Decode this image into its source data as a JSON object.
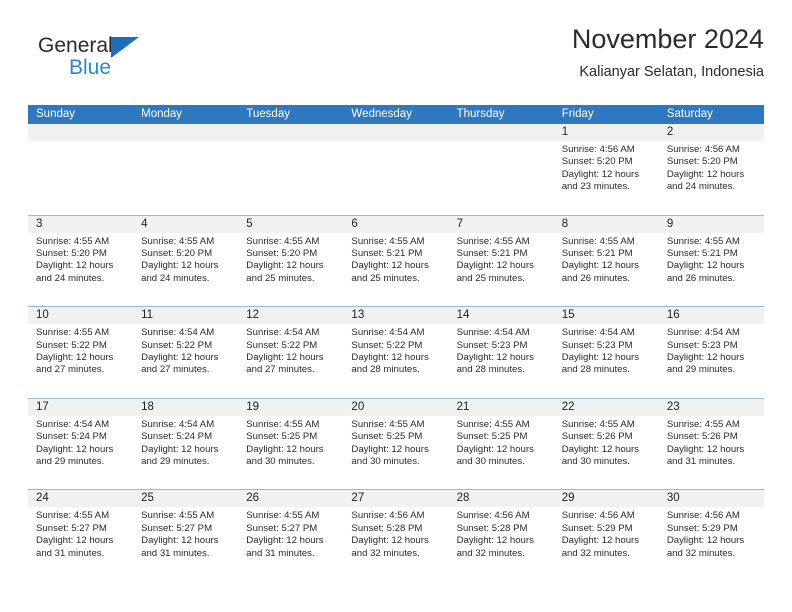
{
  "brand": {
    "name_part1": "General",
    "name_part2": "Blue",
    "triangle_icon": "triangle-icon",
    "accent_dark": "#2b2b2b",
    "accent_blue": "#2a87d8",
    "triangle_blue": "#1b70b8"
  },
  "header": {
    "title": "November 2024",
    "subtitle": "Kalianyar Selatan, Indonesia"
  },
  "calendar": {
    "header_bg": "#2d78bf",
    "daynum_bg": "#f1f1f1",
    "row_divider": "#9bb8d4",
    "weekdays": [
      "Sunday",
      "Monday",
      "Tuesday",
      "Wednesday",
      "Thursday",
      "Friday",
      "Saturday"
    ],
    "weeks": [
      [
        {
          "day": "",
          "empty": true,
          "sunrise": "",
          "sunset": "",
          "daylight_1": "",
          "daylight_2": ""
        },
        {
          "day": "",
          "empty": true,
          "sunrise": "",
          "sunset": "",
          "daylight_1": "",
          "daylight_2": ""
        },
        {
          "day": "",
          "empty": true,
          "sunrise": "",
          "sunset": "",
          "daylight_1": "",
          "daylight_2": ""
        },
        {
          "day": "",
          "empty": true,
          "sunrise": "",
          "sunset": "",
          "daylight_1": "",
          "daylight_2": ""
        },
        {
          "day": "",
          "empty": true,
          "sunrise": "",
          "sunset": "",
          "daylight_1": "",
          "daylight_2": ""
        },
        {
          "day": "1",
          "empty": false,
          "sunrise": "Sunrise: 4:56 AM",
          "sunset": "Sunset: 5:20 PM",
          "daylight_1": "Daylight: 12 hours",
          "daylight_2": "and 23 minutes."
        },
        {
          "day": "2",
          "empty": false,
          "sunrise": "Sunrise: 4:56 AM",
          "sunset": "Sunset: 5:20 PM",
          "daylight_1": "Daylight: 12 hours",
          "daylight_2": "and 24 minutes."
        }
      ],
      [
        {
          "day": "3",
          "empty": false,
          "sunrise": "Sunrise: 4:55 AM",
          "sunset": "Sunset: 5:20 PM",
          "daylight_1": "Daylight: 12 hours",
          "daylight_2": "and 24 minutes."
        },
        {
          "day": "4",
          "empty": false,
          "sunrise": "Sunrise: 4:55 AM",
          "sunset": "Sunset: 5:20 PM",
          "daylight_1": "Daylight: 12 hours",
          "daylight_2": "and 24 minutes."
        },
        {
          "day": "5",
          "empty": false,
          "sunrise": "Sunrise: 4:55 AM",
          "sunset": "Sunset: 5:20 PM",
          "daylight_1": "Daylight: 12 hours",
          "daylight_2": "and 25 minutes."
        },
        {
          "day": "6",
          "empty": false,
          "sunrise": "Sunrise: 4:55 AM",
          "sunset": "Sunset: 5:21 PM",
          "daylight_1": "Daylight: 12 hours",
          "daylight_2": "and 25 minutes."
        },
        {
          "day": "7",
          "empty": false,
          "sunrise": "Sunrise: 4:55 AM",
          "sunset": "Sunset: 5:21 PM",
          "daylight_1": "Daylight: 12 hours",
          "daylight_2": "and 25 minutes."
        },
        {
          "day": "8",
          "empty": false,
          "sunrise": "Sunrise: 4:55 AM",
          "sunset": "Sunset: 5:21 PM",
          "daylight_1": "Daylight: 12 hours",
          "daylight_2": "and 26 minutes."
        },
        {
          "day": "9",
          "empty": false,
          "sunrise": "Sunrise: 4:55 AM",
          "sunset": "Sunset: 5:21 PM",
          "daylight_1": "Daylight: 12 hours",
          "daylight_2": "and 26 minutes."
        }
      ],
      [
        {
          "day": "10",
          "empty": false,
          "sunrise": "Sunrise: 4:55 AM",
          "sunset": "Sunset: 5:22 PM",
          "daylight_1": "Daylight: 12 hours",
          "daylight_2": "and 27 minutes."
        },
        {
          "day": "11",
          "empty": false,
          "sunrise": "Sunrise: 4:54 AM",
          "sunset": "Sunset: 5:22 PM",
          "daylight_1": "Daylight: 12 hours",
          "daylight_2": "and 27 minutes."
        },
        {
          "day": "12",
          "empty": false,
          "sunrise": "Sunrise: 4:54 AM",
          "sunset": "Sunset: 5:22 PM",
          "daylight_1": "Daylight: 12 hours",
          "daylight_2": "and 27 minutes."
        },
        {
          "day": "13",
          "empty": false,
          "sunrise": "Sunrise: 4:54 AM",
          "sunset": "Sunset: 5:22 PM",
          "daylight_1": "Daylight: 12 hours",
          "daylight_2": "and 28 minutes."
        },
        {
          "day": "14",
          "empty": false,
          "sunrise": "Sunrise: 4:54 AM",
          "sunset": "Sunset: 5:23 PM",
          "daylight_1": "Daylight: 12 hours",
          "daylight_2": "and 28 minutes."
        },
        {
          "day": "15",
          "empty": false,
          "sunrise": "Sunrise: 4:54 AM",
          "sunset": "Sunset: 5:23 PM",
          "daylight_1": "Daylight: 12 hours",
          "daylight_2": "and 28 minutes."
        },
        {
          "day": "16",
          "empty": false,
          "sunrise": "Sunrise: 4:54 AM",
          "sunset": "Sunset: 5:23 PM",
          "daylight_1": "Daylight: 12 hours",
          "daylight_2": "and 29 minutes."
        }
      ],
      [
        {
          "day": "17",
          "empty": false,
          "sunrise": "Sunrise: 4:54 AM",
          "sunset": "Sunset: 5:24 PM",
          "daylight_1": "Daylight: 12 hours",
          "daylight_2": "and 29 minutes."
        },
        {
          "day": "18",
          "empty": false,
          "sunrise": "Sunrise: 4:54 AM",
          "sunset": "Sunset: 5:24 PM",
          "daylight_1": "Daylight: 12 hours",
          "daylight_2": "and 29 minutes."
        },
        {
          "day": "19",
          "empty": false,
          "sunrise": "Sunrise: 4:55 AM",
          "sunset": "Sunset: 5:25 PM",
          "daylight_1": "Daylight: 12 hours",
          "daylight_2": "and 30 minutes."
        },
        {
          "day": "20",
          "empty": false,
          "sunrise": "Sunrise: 4:55 AM",
          "sunset": "Sunset: 5:25 PM",
          "daylight_1": "Daylight: 12 hours",
          "daylight_2": "and 30 minutes."
        },
        {
          "day": "21",
          "empty": false,
          "sunrise": "Sunrise: 4:55 AM",
          "sunset": "Sunset: 5:25 PM",
          "daylight_1": "Daylight: 12 hours",
          "daylight_2": "and 30 minutes."
        },
        {
          "day": "22",
          "empty": false,
          "sunrise": "Sunrise: 4:55 AM",
          "sunset": "Sunset: 5:26 PM",
          "daylight_1": "Daylight: 12 hours",
          "daylight_2": "and 30 minutes."
        },
        {
          "day": "23",
          "empty": false,
          "sunrise": "Sunrise: 4:55 AM",
          "sunset": "Sunset: 5:26 PM",
          "daylight_1": "Daylight: 12 hours",
          "daylight_2": "and 31 minutes."
        }
      ],
      [
        {
          "day": "24",
          "empty": false,
          "sunrise": "Sunrise: 4:55 AM",
          "sunset": "Sunset: 5:27 PM",
          "daylight_1": "Daylight: 12 hours",
          "daylight_2": "and 31 minutes."
        },
        {
          "day": "25",
          "empty": false,
          "sunrise": "Sunrise: 4:55 AM",
          "sunset": "Sunset: 5:27 PM",
          "daylight_1": "Daylight: 12 hours",
          "daylight_2": "and 31 minutes."
        },
        {
          "day": "26",
          "empty": false,
          "sunrise": "Sunrise: 4:55 AM",
          "sunset": "Sunset: 5:27 PM",
          "daylight_1": "Daylight: 12 hours",
          "daylight_2": "and 31 minutes."
        },
        {
          "day": "27",
          "empty": false,
          "sunrise": "Sunrise: 4:56 AM",
          "sunset": "Sunset: 5:28 PM",
          "daylight_1": "Daylight: 12 hours",
          "daylight_2": "and 32 minutes."
        },
        {
          "day": "28",
          "empty": false,
          "sunrise": "Sunrise: 4:56 AM",
          "sunset": "Sunset: 5:28 PM",
          "daylight_1": "Daylight: 12 hours",
          "daylight_2": "and 32 minutes."
        },
        {
          "day": "29",
          "empty": false,
          "sunrise": "Sunrise: 4:56 AM",
          "sunset": "Sunset: 5:29 PM",
          "daylight_1": "Daylight: 12 hours",
          "daylight_2": "and 32 minutes."
        },
        {
          "day": "30",
          "empty": false,
          "sunrise": "Sunrise: 4:56 AM",
          "sunset": "Sunset: 5:29 PM",
          "daylight_1": "Daylight: 12 hours",
          "daylight_2": "and 32 minutes."
        }
      ]
    ]
  }
}
